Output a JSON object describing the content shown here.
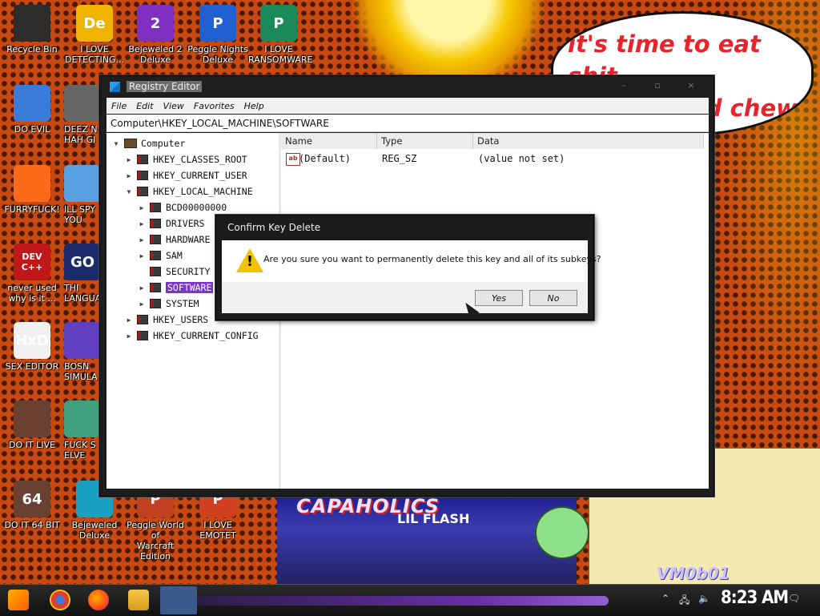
{
  "desktop": {
    "speech_bubble": "it's time to eat shit\nand die and chew\nw",
    "poster": {
      "title": "CAPAHOLICS",
      "subtitle": "LIL FLASH"
    },
    "watermark": "VM0b01",
    "icons": [
      {
        "label": "Recycle Bin",
        "icon": "recycle-bin-icon",
        "color": "#2d2d2d"
      },
      {
        "label": "I LOVE\nDETECTING...",
        "icon": "detect-it-easy-icon",
        "color": "#f0b400",
        "glyph": "De"
      },
      {
        "label": "Bejeweled 2\nDeluxe",
        "icon": "bejeweled-2-icon",
        "color": "#8030c0",
        "glyph": "2"
      },
      {
        "label": "Peggle Nights\nDeluxe",
        "icon": "peggle-nights-icon",
        "color": "#2060d0",
        "glyph": "P"
      },
      {
        "label": "I LOVE\nRANSOMWARE",
        "icon": "publisher-icon",
        "color": "#1a8a5a",
        "glyph": "P"
      },
      {
        "label": "DO EVIL",
        "icon": "chrome-icon",
        "color": "#3a7ad8"
      },
      {
        "label": "DEEZ N\nHAH GI",
        "icon": "file-icon",
        "color": "#666"
      },
      {
        "label": "FURRYFUCK!",
        "icon": "firefox-icon",
        "color": "#ff6a1a"
      },
      {
        "label": "ILL SPY\nYOU",
        "icon": "spy-tool-icon",
        "color": "#5aa0e0"
      },
      {
        "label": "never used\nwhy is it ...",
        "icon": "dev-cpp-icon",
        "color": "#c01818",
        "glyph": "DEV C++"
      },
      {
        "label": "THI\nLANGUA",
        "icon": "go-language-icon",
        "color": "#1a2a6a",
        "glyph": "GO"
      },
      {
        "label": "SEX EDITOR",
        "icon": "hxd-hex-editor-icon",
        "color": "#f0f0f0",
        "glyph": "HxD"
      },
      {
        "label": "BOSN\nSIMULA",
        "icon": "purple-sphere-icon",
        "color": "#6040c0"
      },
      {
        "label": "DO IT LIVE",
        "icon": "portrait-icon",
        "color": "#6a4030"
      },
      {
        "label": "FUCK S\nELVE",
        "icon": "game-icon",
        "color": "#40a080"
      },
      {
        "label": "DO IT 64 BIT",
        "icon": "portrait-64-icon",
        "color": "#6a4030",
        "glyph": "64"
      },
      {
        "label": "Bejeweled\nDeluxe",
        "icon": "bejeweled-icon",
        "color": "#1aa0c0"
      },
      {
        "label": "Peggle World of\nWarcraft Edition",
        "icon": "peggle-wow-icon",
        "color": "#c04020",
        "glyph": "P"
      },
      {
        "label": "I LOVE EMOTET",
        "icon": "powerpoint-icon",
        "color": "#d04020",
        "glyph": "P"
      }
    ]
  },
  "regedit": {
    "title": "Registry Editor",
    "menu": [
      "File",
      "Edit",
      "View",
      "Favorites",
      "Help"
    ],
    "address": "Computer\\HKEY_LOCAL_MACHINE\\SOFTWARE",
    "tree": [
      {
        "label": "Computer",
        "arrow": "▼",
        "indent": 0,
        "kind": "pc"
      },
      {
        "label": "HKEY_CLASSES_ROOT",
        "arrow": "▶",
        "indent": 1
      },
      {
        "label": "HKEY_CURRENT_USER",
        "arrow": "▶",
        "indent": 1
      },
      {
        "label": "HKEY_LOCAL_MACHINE",
        "arrow": "▼",
        "indent": 1
      },
      {
        "label": "BCD00000000",
        "arrow": "▶",
        "indent": 2
      },
      {
        "label": "DRIVERS",
        "arrow": "▶",
        "indent": 2
      },
      {
        "label": "HARDWARE",
        "arrow": "▶",
        "indent": 2
      },
      {
        "label": "SAM",
        "arrow": "▶",
        "indent": 2
      },
      {
        "label": "SECURITY",
        "arrow": "",
        "indent": 2
      },
      {
        "label": "SOFTWARE",
        "arrow": "▶",
        "indent": 2,
        "selected": true
      },
      {
        "label": "SYSTEM",
        "arrow": "▶",
        "indent": 2
      },
      {
        "label": "HKEY_USERS",
        "arrow": "▶",
        "indent": 1
      },
      {
        "label": "HKEY_CURRENT_CONFIG",
        "arrow": "▶",
        "indent": 1
      }
    ],
    "columns": [
      "Name",
      "Type",
      "Data"
    ],
    "values": [
      {
        "name": "(Default)",
        "type": "REG_SZ",
        "data": "(value not set)",
        "icon": "string-value-icon"
      }
    ]
  },
  "dialog": {
    "title": "Confirm Key Delete",
    "message": "Are you sure you want to permanently delete this key and all of its subkeys?",
    "yes_label": "Yes",
    "no_label": "No"
  },
  "taskbar": {
    "clock": "8:23 AM",
    "pinned": [
      "start-icon",
      "chrome-icon",
      "firefox-icon",
      "file-explorer-icon",
      "registry-editor-icon"
    ]
  }
}
